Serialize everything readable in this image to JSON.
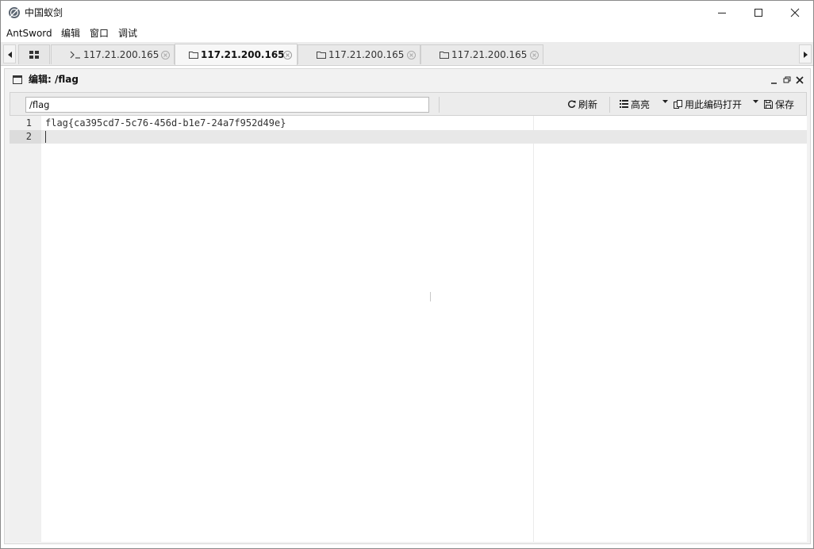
{
  "window": {
    "title": "中国蚁剑",
    "controls": {
      "minimize": "minimize-icon",
      "maximize": "maximize-icon",
      "close": "close-icon"
    }
  },
  "menu": [
    {
      "label": "AntSword"
    },
    {
      "label": "编辑"
    },
    {
      "label": "窗口"
    },
    {
      "label": "调试"
    }
  ],
  "tabs": [
    {
      "label": "117.21.200.165",
      "icon": "terminal-icon",
      "active": false
    },
    {
      "label": "117.21.200.165",
      "icon": "folder-icon",
      "active": true
    },
    {
      "label": "117.21.200.165",
      "icon": "folder-icon",
      "active": false
    },
    {
      "label": "117.21.200.165",
      "icon": "folder-icon",
      "active": false
    }
  ],
  "panel": {
    "title": "编辑: /flag",
    "path_value": "/flag",
    "toolbar": {
      "refresh": "刷新",
      "highlight": "高亮",
      "open_with_encoding": "用此编码打开",
      "save": "保存"
    }
  },
  "editor": {
    "lines": [
      {
        "num": "1",
        "text": "flag{ca395cd7-5c76-456d-b1e7-24a7f952d49e}"
      },
      {
        "num": "2",
        "text": ""
      }
    ],
    "active_line": 2
  },
  "colors": {
    "tabbar_bg": "#ececec",
    "panel_bg": "#f2f2f2",
    "gutter_bg": "#f0f0f0",
    "active_line_bg": "#e8e8e8"
  }
}
